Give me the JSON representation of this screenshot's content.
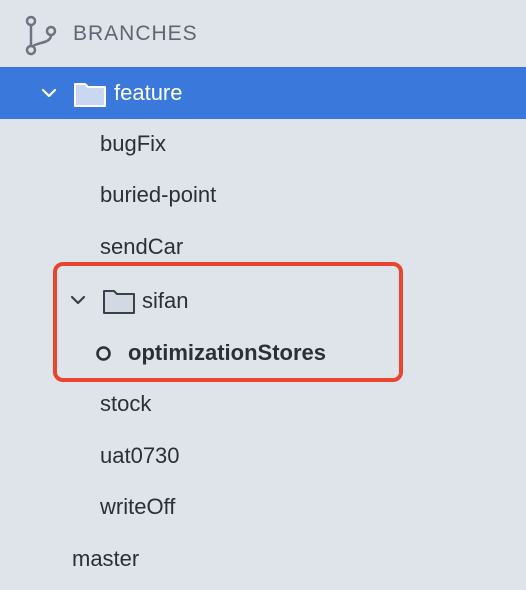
{
  "section": {
    "title": "BRANCHES",
    "icon": "branch-icon"
  },
  "tree": {
    "feature": {
      "label": "feature",
      "icon": "folder-icon",
      "expanded": true,
      "selected": true,
      "children": {
        "bugFix": "bugFix",
        "buriedPoint": "buried-point",
        "sendCar": "sendCar",
        "sifan": {
          "label": "sifan",
          "icon": "folder-icon",
          "expanded": true,
          "children": {
            "optimizationStores": {
              "label": "optimizationStores",
              "current": true
            }
          }
        },
        "stock": "stock",
        "uat0730": "uat0730",
        "writeOff": "writeOff"
      }
    },
    "master": "master"
  },
  "colors": {
    "sidebar_bg": "#dfe3ea",
    "selection": "#3a78db",
    "annotation_box": "#e8452f",
    "text": "#2b2f36",
    "header_text": "#5e6672"
  }
}
